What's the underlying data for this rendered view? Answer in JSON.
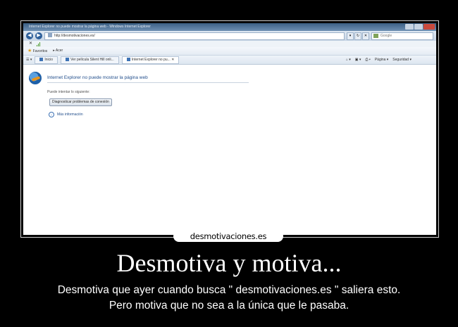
{
  "browser": {
    "window_title": "Internet Explorer no puede mostrar la página web - Windows Internet Explorer",
    "address": "http://desmotivaciones.es/",
    "search_placeholder": "Google",
    "status_x": "✕",
    "favorites_label": "Favoritos",
    "add_label": "Acer",
    "tabs": [
      {
        "label": "Inicio"
      },
      {
        "label": "Ver película Silent Hill onli..."
      },
      {
        "label": "Internet Explorer no pu..."
      }
    ],
    "tools": {
      "page_label": "Página ▾",
      "security_label": "Seguridad ▾"
    }
  },
  "page": {
    "heading": "Internet Explorer no puede mostrar la página web",
    "hint": "Puede intentar lo siguiente:",
    "diagnose_button": "Diagnosticar problemas de conexión",
    "more_info": "Más información"
  },
  "poster": {
    "watermark": "desmotivaciones.es",
    "title": "Desmotiva y motiva...",
    "caption_line1": "Desmotiva que ayer cuando busca \" desmotivaciones.es \" saliera esto.",
    "caption_line2": "Pero motiva que no sea a la única que le pasaba."
  }
}
